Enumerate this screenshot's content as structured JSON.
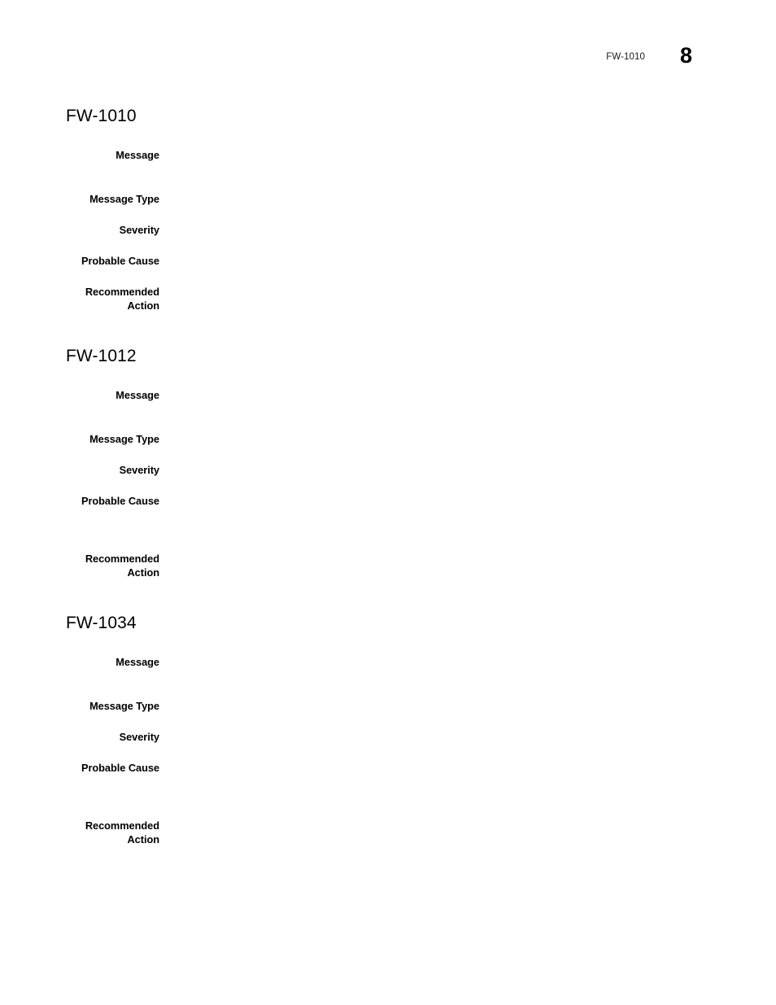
{
  "document": {
    "header": {
      "reference": "FW-1010",
      "page_number": "8"
    }
  },
  "labels": {
    "message": "Message",
    "message_type": "Message Type",
    "severity": "Severity",
    "probable_cause": "Probable Cause",
    "recommended_action": "Recommended\nAction"
  },
  "sections": [
    {
      "id": "fw-1010",
      "heading": "FW-1010",
      "fields": {
        "message": "",
        "message_type": "",
        "severity": "",
        "probable_cause": "",
        "recommended_action": ""
      }
    },
    {
      "id": "fw-1012",
      "heading": "FW-1012",
      "fields": {
        "message": "",
        "message_type": "",
        "severity": "",
        "probable_cause": "",
        "recommended_action": ""
      }
    },
    {
      "id": "fw-1034",
      "heading": "FW-1034",
      "fields": {
        "message": "",
        "message_type": "",
        "severity": "",
        "probable_cause": "",
        "recommended_action": ""
      }
    }
  ]
}
